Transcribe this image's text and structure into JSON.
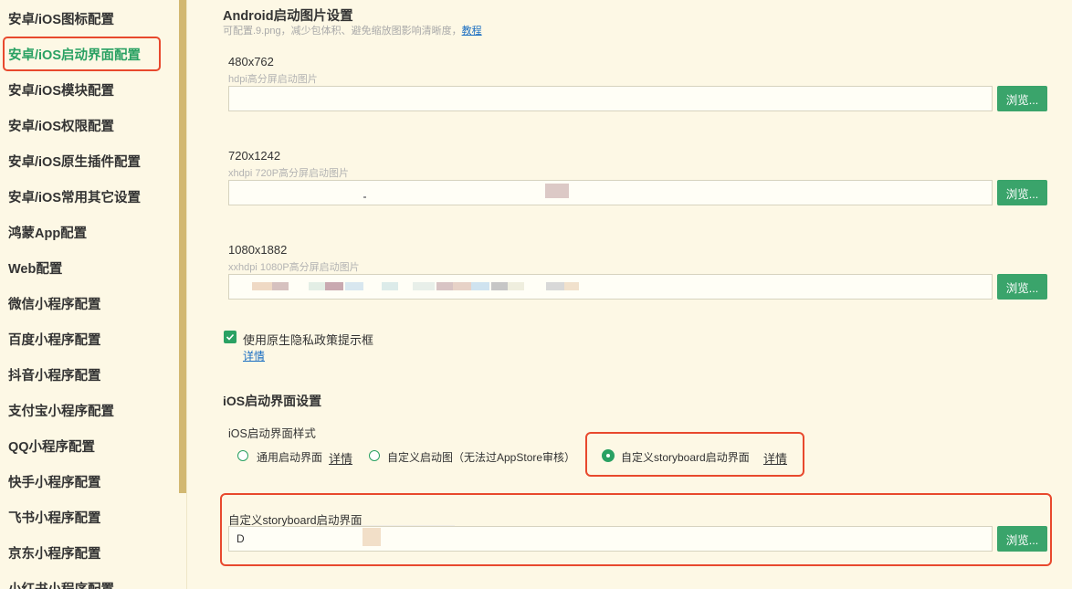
{
  "sidebar": {
    "items": [
      {
        "label": "安卓/iOS图标配置",
        "active": false
      },
      {
        "label": "安卓/iOS启动界面配置",
        "active": true
      },
      {
        "label": "安卓/iOS模块配置",
        "active": false
      },
      {
        "label": "安卓/iOS权限配置",
        "active": false
      },
      {
        "label": "安卓/iOS原生插件配置",
        "active": false
      },
      {
        "label": "安卓/iOS常用其它设置",
        "active": false
      },
      {
        "label": "鸿蒙App配置",
        "active": false
      },
      {
        "label": "Web配置",
        "active": false
      },
      {
        "label": "微信小程序配置",
        "active": false
      },
      {
        "label": "百度小程序配置",
        "active": false
      },
      {
        "label": "抖音小程序配置",
        "active": false
      },
      {
        "label": "支付宝小程序配置",
        "active": false
      },
      {
        "label": "QQ小程序配置",
        "active": false
      },
      {
        "label": "快手小程序配置",
        "active": false
      },
      {
        "label": "飞书小程序配置",
        "active": false
      },
      {
        "label": "京东小程序配置",
        "active": false
      },
      {
        "label": "小红书小程序配置",
        "active": false
      }
    ]
  },
  "android": {
    "title": "Android启动图片设置",
    "subtitle": "可配置.9.png，减少包体积、避免缩放图影响清晰度，",
    "tutorial_link": "教程",
    "fields": [
      {
        "label": "480x762",
        "hint": "hdpi高分屏启动图片",
        "value": "",
        "browse": "浏览..."
      },
      {
        "label": "720x1242",
        "hint": "xhdpi 720P高分屏启动图片",
        "value": "",
        "browse": "浏览..."
      },
      {
        "label": "1080x1882",
        "hint": "xxhdpi 1080P高分屏启动图片",
        "value": "",
        "browse": "浏览..."
      }
    ],
    "privacy_checkbox": {
      "label": "使用原生隐私政策提示框",
      "checked": true,
      "detail_link": "详情"
    }
  },
  "ios": {
    "title": "iOS启动界面设置",
    "style_label": "iOS启动界面样式",
    "options": [
      {
        "label": "通用启动界面",
        "detail_link": "详情",
        "checked": false
      },
      {
        "label": "自定义启动图（无法过AppStore审核）",
        "checked": false
      },
      {
        "label": "自定义storyboard启动界面",
        "detail_link": "详情",
        "checked": true
      }
    ],
    "storyboard": {
      "label": "自定义storyboard启动界面",
      "value": "D",
      "browse": "浏览..."
    }
  },
  "colors": {
    "accent": "#2aa163",
    "button": "#3aa46b",
    "highlight": "#e8492d",
    "link": "#1a6ec2"
  }
}
